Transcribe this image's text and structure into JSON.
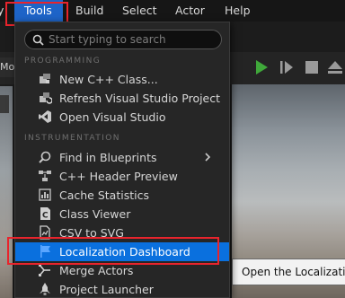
{
  "menubar": {
    "items": [
      {
        "label": "y"
      },
      {
        "label": "Tools",
        "active": true
      },
      {
        "label": "Build"
      },
      {
        "label": "Select"
      },
      {
        "label": "Actor"
      },
      {
        "label": "Help"
      }
    ]
  },
  "toolbar": {
    "left_label": "Mo"
  },
  "dropdown": {
    "search_placeholder": "Start typing to search",
    "sections": [
      {
        "title": "PROGRAMMING"
      },
      {
        "title": "INSTRUMENTATION"
      }
    ],
    "items": [
      {
        "label": "New C++ Class...",
        "icon": "cpp-class-icon"
      },
      {
        "label": "Refresh Visual Studio Project",
        "icon": "refresh-project-icon"
      },
      {
        "label": "Open Visual Studio",
        "icon": "visual-studio-icon"
      },
      {
        "label": "Find in Blueprints",
        "icon": "find-in-blueprints-icon",
        "submenu": true
      },
      {
        "label": "C++ Header Preview",
        "icon": "header-preview-icon"
      },
      {
        "label": "Cache Statistics",
        "icon": "cache-statistics-icon"
      },
      {
        "label": "Class Viewer",
        "icon": "class-viewer-icon"
      },
      {
        "label": "CSV to SVG",
        "icon": "csv-to-svg-icon"
      },
      {
        "label": "Localization Dashboard",
        "icon": "localization-flag-icon",
        "highlighted": true
      },
      {
        "label": "Merge Actors",
        "icon": "merge-actors-icon"
      },
      {
        "label": "Project Launcher",
        "icon": "project-launcher-icon"
      }
    ]
  },
  "tooltip": {
    "text": "Open the Localization"
  },
  "colors": {
    "accent": "#0a70de",
    "menu_active": "#1e64c8",
    "highlight_box": "#e8242c",
    "play_green": "#3fa83a"
  }
}
